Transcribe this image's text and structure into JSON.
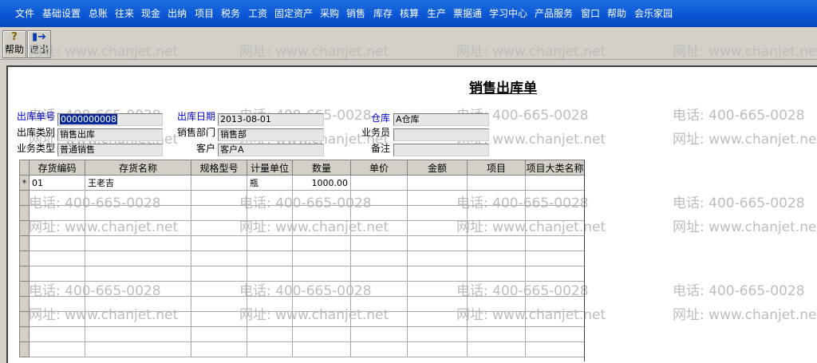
{
  "menu": [
    "文件",
    "基础设置",
    "总账",
    "往来",
    "现金",
    "出纳",
    "项目",
    "税务",
    "工资",
    "固定资产",
    "采购",
    "销售",
    "库存",
    "核算",
    "生产",
    "票据通",
    "学习中心",
    "产品服务",
    "窗口",
    "帮助",
    "会乐家园"
  ],
  "toolbar": {
    "help": "帮助",
    "exit": "退出"
  },
  "watermark": {
    "phone": "电话: 400-665-0028",
    "web": "网址: www.chanjet.net"
  },
  "form": {
    "title": "销售出库单",
    "fields": {
      "no": {
        "label": "出库单号",
        "value": "0000000008"
      },
      "date": {
        "label": "出库日期",
        "value": "2013-08-01"
      },
      "warehouse": {
        "label": "仓库",
        "value": "A仓库"
      },
      "type": {
        "label": "出库类别",
        "value": "销售出库"
      },
      "dept": {
        "label": "销售部门",
        "value": "销售部"
      },
      "salesman": {
        "label": "业务员",
        "value": ""
      },
      "biz": {
        "label": "业务类型",
        "value": "普通销售"
      },
      "customer": {
        "label": "客户",
        "value": "客户A"
      },
      "note": {
        "label": "备注",
        "value": ""
      }
    }
  },
  "grid": {
    "headers": [
      "存货编码",
      "存货名称",
      "规格型号",
      "计量单位",
      "数量",
      "单价",
      "金额",
      "项目",
      "项目大类名称"
    ],
    "row1": {
      "marker": "*",
      "code": "01",
      "name": "王老吉",
      "spec": "",
      "unit": "瓶",
      "qty": "1000.00",
      "price": "",
      "amount": "",
      "project": "",
      "category": ""
    }
  }
}
